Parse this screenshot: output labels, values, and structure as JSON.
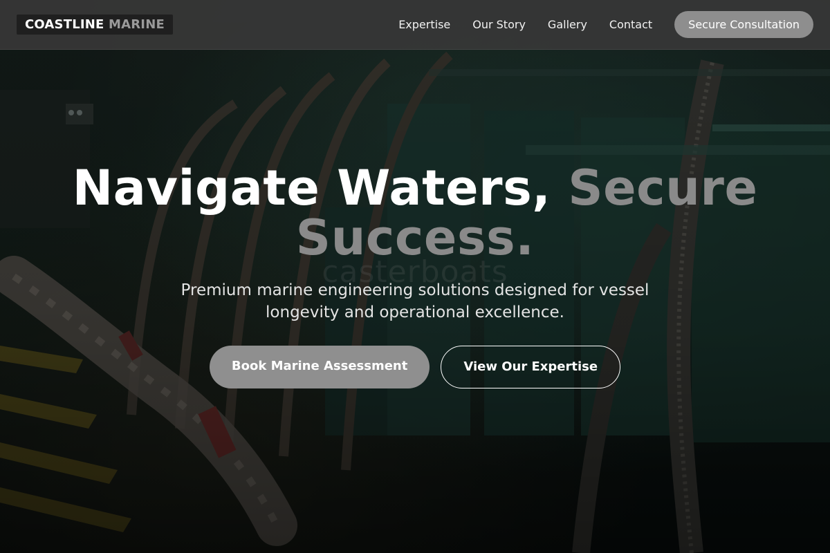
{
  "brand": {
    "name_primary": "COASTLINE",
    "name_secondary": "MARINE"
  },
  "nav": {
    "links": [
      {
        "label": "Expertise"
      },
      {
        "label": "Our Story"
      },
      {
        "label": "Gallery"
      },
      {
        "label": "Contact"
      }
    ],
    "cta_label": "Secure Consultation"
  },
  "hero": {
    "headline_main": "Navigate Waters,",
    "headline_accent_1": "Secure",
    "headline_accent_2": "Success.",
    "watermark": "casterboats",
    "subhead": "Premium marine engineering solutions designed for vessel longevity and operational excellence.",
    "primary_button": "Book Marine Assessment",
    "secondary_button": "View Our Expertise"
  },
  "colors": {
    "nav_background": "#373737",
    "accent_gray": "#8e8e8e",
    "text_white": "#ffffff"
  }
}
